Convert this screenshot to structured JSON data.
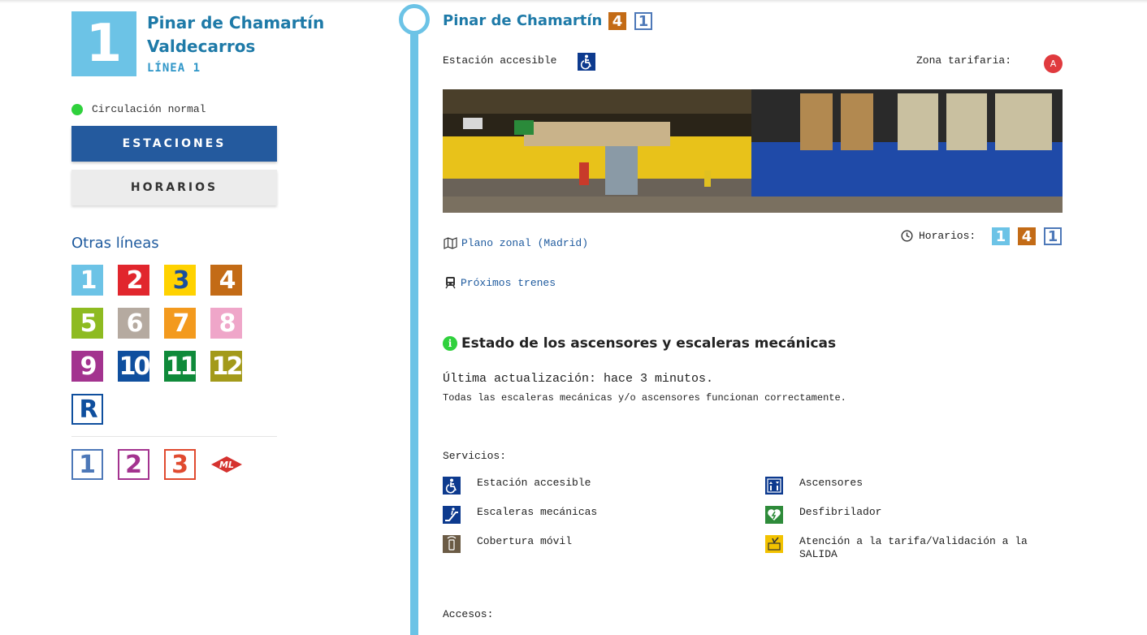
{
  "line": {
    "number": "1",
    "name_line1": "Pinar de Chamartín",
    "name_line2": "Valdecarros",
    "label": "LÍNEA 1",
    "color": "#6cc3e6"
  },
  "status": {
    "text": "Circulación normal",
    "color": "#2fd13c"
  },
  "buttons": {
    "stations": "ESTACIONES",
    "schedules": "HORARIOS"
  },
  "other_lines": {
    "title": "Otras líneas",
    "metro": [
      {
        "label": "1",
        "color": "#6cc3e6",
        "text_color": "#fff"
      },
      {
        "label": "2",
        "color": "#e1262d",
        "text_color": "#fff"
      },
      {
        "label": "3",
        "color": "#ffd200",
        "text_color": "#1a4f9e"
      },
      {
        "label": "4",
        "color": "#c36b16",
        "text_color": "#fff"
      },
      {
        "label": "5",
        "color": "#8ebb21",
        "text_color": "#fff"
      },
      {
        "label": "6",
        "color": "#b5aaa0",
        "text_color": "#fff"
      },
      {
        "label": "7",
        "color": "#f39a1e",
        "text_color": "#fff"
      },
      {
        "label": "8",
        "color": "#efa6c9",
        "text_color": "#fff"
      },
      {
        "label": "9",
        "color": "#a3338f",
        "text_color": "#fff"
      },
      {
        "label": "10",
        "color": "#0f4f9e",
        "text_color": "#fff"
      },
      {
        "label": "11",
        "color": "#0f8a3a",
        "text_color": "#fff"
      },
      {
        "label": "12",
        "color": "#a39a1a",
        "text_color": "#fff"
      },
      {
        "label": "R",
        "color": "#ffffff",
        "text_color": "#0f4f9e",
        "border": "#0f4f9e"
      }
    ],
    "light_rail": [
      {
        "label": "1",
        "color": "#4d78b8"
      },
      {
        "label": "2",
        "color": "#a3338f"
      },
      {
        "label": "3",
        "color": "#e04a2f"
      }
    ],
    "ml_logo": "ML",
    "ml_color": "#d5322f"
  },
  "station": {
    "name": "Pinar de Chamartín",
    "connections": [
      {
        "label": "4",
        "type": "metro",
        "color": "#c36b16"
      },
      {
        "label": "1",
        "type": "light",
        "color": "#4d78b8"
      }
    ],
    "accessible_label": "Estación accesible",
    "zone_label": "Zona tarifaria:",
    "zone": "A",
    "zone_color": "#e03a3e",
    "map_link": "Plano zonal (Madrid)",
    "trains_link": "Próximos trenes",
    "schedules_label": "Horarios:",
    "schedules": [
      {
        "label": "1",
        "type": "metro",
        "color": "#6cc3e6"
      },
      {
        "label": "4",
        "type": "metro",
        "color": "#c36b16"
      },
      {
        "label": "1",
        "type": "light",
        "color": "#4d78b8"
      }
    ]
  },
  "elevators": {
    "title": "Estado de los ascensores y escaleras mecánicas",
    "updated": "Última actualización: hace 3 minutos.",
    "message": "Todas las escaleras mecánicas y/o ascensores funcionan correctamente."
  },
  "services": {
    "title": "Servicios:",
    "items": [
      {
        "label": "Estación accesible",
        "icon": "wheelchair-icon",
        "color": "#0d3a8e"
      },
      {
        "label": "Ascensores",
        "icon": "elevator-icon",
        "color": "#0d3a8e"
      },
      {
        "label": "Escaleras mecánicas",
        "icon": "escalator-icon",
        "color": "#0d3a8e"
      },
      {
        "label": "Desfibrilador",
        "icon": "defibrillator-icon",
        "color": "#2e8b3a"
      },
      {
        "label": "Cobertura móvil",
        "icon": "mobile-coverage-icon",
        "color": "#6b5b45"
      },
      {
        "label": "Atención a la tarifa/Validación a la SALIDA",
        "icon": "ticket-validation-icon",
        "color": "#f2c200"
      }
    ]
  },
  "accesses": {
    "title": "Accesos:"
  }
}
